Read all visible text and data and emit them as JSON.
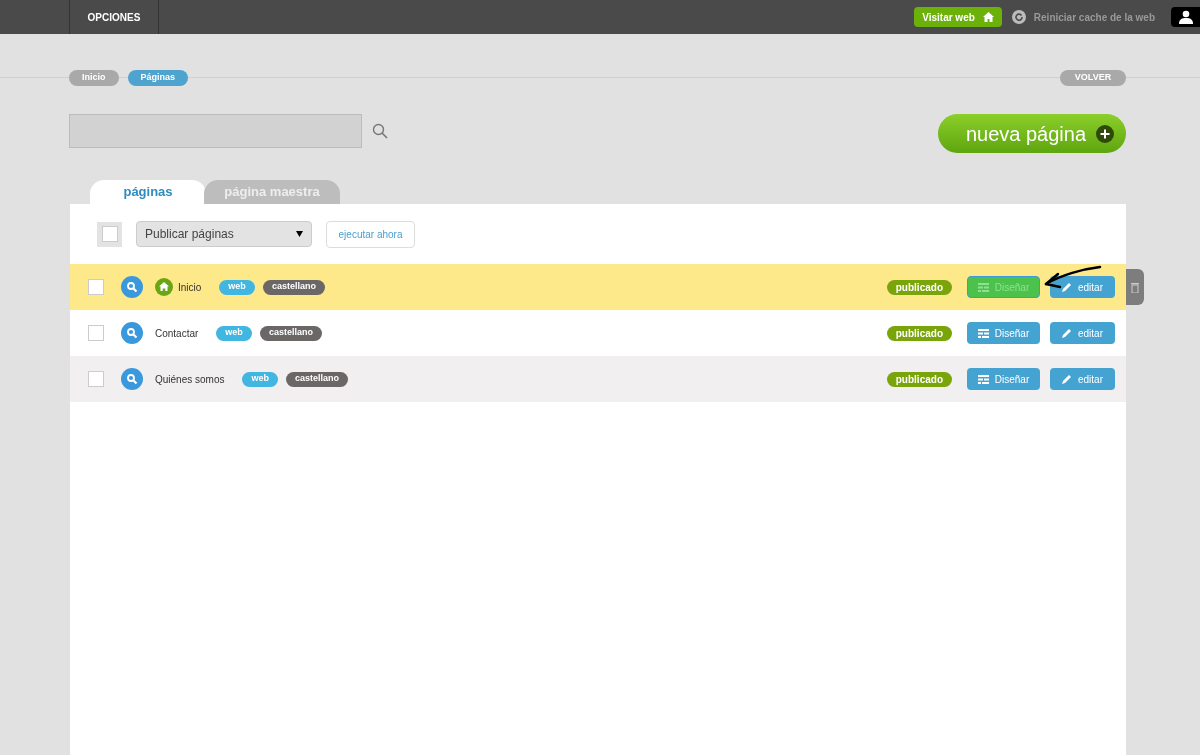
{
  "top_bar": {
    "menu": "OPCIONES",
    "visit_button": "Visitar web",
    "cache_link": "Reiniciar cache de la web"
  },
  "breadcrumbs": [
    {
      "label": "Inicio",
      "selected": false
    },
    {
      "label": "Páginas",
      "selected": true
    }
  ],
  "back_button": "VOLVER",
  "new_page_button": "nueva página",
  "tabs": [
    {
      "label": "páginas",
      "selected": true
    },
    {
      "label": "página maestra",
      "selected": false
    }
  ],
  "select_all": {
    "checked": false
  },
  "bulk_action": {
    "value": "Publicar páginas",
    "run_button": "ejecutar ahora"
  },
  "rows": [
    {
      "title": "Inicio",
      "home": true,
      "highlighted": true,
      "tags": [
        "web",
        "castellano"
      ],
      "status": "publicado",
      "design_button": "Diseñar",
      "edit_button": "editar",
      "annotated": true
    },
    {
      "title": "Contactar",
      "home": false,
      "highlighted": false,
      "tags": [
        "web",
        "castellano"
      ],
      "status": "publicado",
      "design_button": "Diseñar",
      "edit_button": "editar",
      "annotated": false
    },
    {
      "title": "Quiénes somos",
      "home": false,
      "highlighted": false,
      "tags": [
        "web",
        "castellano"
      ],
      "status": "publicado",
      "design_button": "Diseñar",
      "edit_button": "editar",
      "annotated": false
    }
  ]
}
